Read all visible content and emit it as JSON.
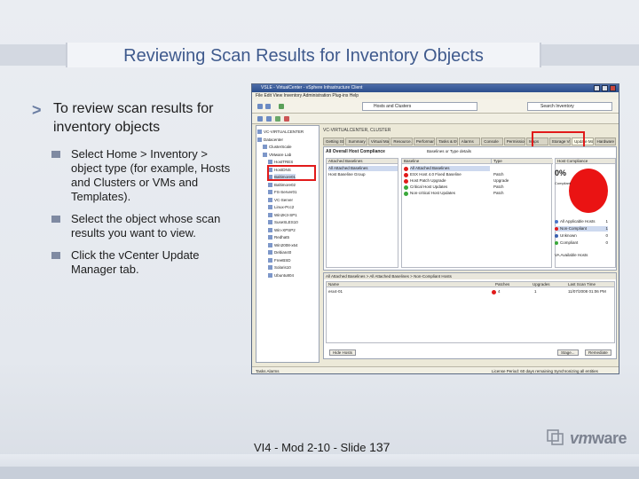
{
  "slide": {
    "title": "Reviewing Scan Results for Inventory Objects",
    "main_bullet": "To review scan results for inventory objects",
    "sub_bullets": [
      "Select Home > Inventory > object type (for example, Hosts and Clusters or VMs and Templates).",
      "Select the object whose scan results you want to view.",
      "Click the vCenter Update Manager tab."
    ],
    "footer_text": "VI4 - Mod 2-10 - Slide",
    "footer_number": "137",
    "logo": {
      "prefix": "vm",
      "suffix": "ware"
    }
  },
  "screenshot": {
    "window_title": "VSLE - VirtualCenter - vSphere Infrastructure Client",
    "menu": "File  Edit  View  Inventory  Administration  Plug-ins  Help",
    "address": "Hosts and Clusters",
    "search_placeholder": "Search Inventory",
    "breadcrumb": "VC-VIRTUALCENTER, CLUSTER",
    "tree_items": [
      "VC-VIRTUALCENTER",
      "Datacenter",
      "ClusterScale",
      "VMware Lab",
      "HostTRES",
      "HostDNS",
      "Baltimore01",
      "Baltimore02",
      "FS-Server01",
      "VC-Server",
      "Linux-Pcc2",
      "Win2K3-SP1",
      "SuseSLES10",
      "Win-XPSP2",
      "Redhat5",
      "Win2008-x64",
      "Debian40",
      "FreeBSD",
      "Solaris10",
      "Ubuntu804"
    ],
    "tabs": [
      "Getting Started",
      "Summary",
      "Virtual Machines",
      "Resource Allocation",
      "Performance",
      "Tasks & Events",
      "Alarms",
      "Console",
      "Permissions",
      "Maps",
      "Storage Views",
      "Update Manager",
      "Hardware Status"
    ],
    "compliance_header": "All Overall Host Compliance",
    "search_label": "Baselines or Type details",
    "col_attached": "Attached Baselines",
    "col_name": "Baseline",
    "col_type": "Type",
    "col_chart": "Host Compliance",
    "attached_rows": [
      "All Attached Baselines",
      "Host Baseline Group"
    ],
    "baselines": [
      {
        "name": "All Attached Baselines",
        "type": ""
      },
      {
        "name": "ESX Host 4.0 Fixed Baseline",
        "type": "Patch"
      },
      {
        "name": "Host Patch Upgrade",
        "type": "Upgrade"
      },
      {
        "name": "Critical Host Updates",
        "type": "Patch"
      },
      {
        "name": "Non-critical Host Updates",
        "type": "Patch"
      }
    ],
    "compliance_pct": "0%",
    "compliance_caption": "Compliant",
    "legend": [
      {
        "label": "All Applicable Hosts",
        "value": "1"
      },
      {
        "label": "Non-Compliant",
        "value": "1"
      },
      {
        "label": "Unknown",
        "value": "0"
      },
      {
        "label": "Compliant",
        "value": "0"
      }
    ],
    "va_note": "VA Available Hosts",
    "detail_header": "All Attached Baselines > All Attached Baselines > Non-Compliant Hosts",
    "detail_cols": [
      "Name",
      "Patches",
      "Upgrades",
      "Last Scan Time"
    ],
    "detail_row": {
      "name": "esx4-01",
      "patches": "4",
      "upgrades": "1",
      "time": "11/07/2008 01:06 PM"
    },
    "hide_label": "Hide Hosts",
    "stage_label": "Stage...",
    "remediate_label": "Remediate",
    "status_left": "Tasks  Alarms",
    "status_right": "License Period: 60 days remaining   Synchronizing all entities   Administrator"
  },
  "colors": {
    "title": "#3f5a8d",
    "highlight": "#e11a1a",
    "pie": "#ea1313"
  }
}
